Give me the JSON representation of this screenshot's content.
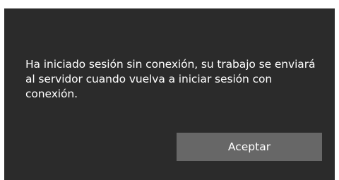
{
  "dialog": {
    "message": "Ha iniciado sesión sin conexión, su trabajo se enviará al servidor cuando vuelva a iniciar sesión con conexión.",
    "accept_label": "Aceptar"
  },
  "colors": {
    "dialog_background": "#2b2b2b",
    "button_background": "#676767",
    "text": "#ffffff"
  }
}
